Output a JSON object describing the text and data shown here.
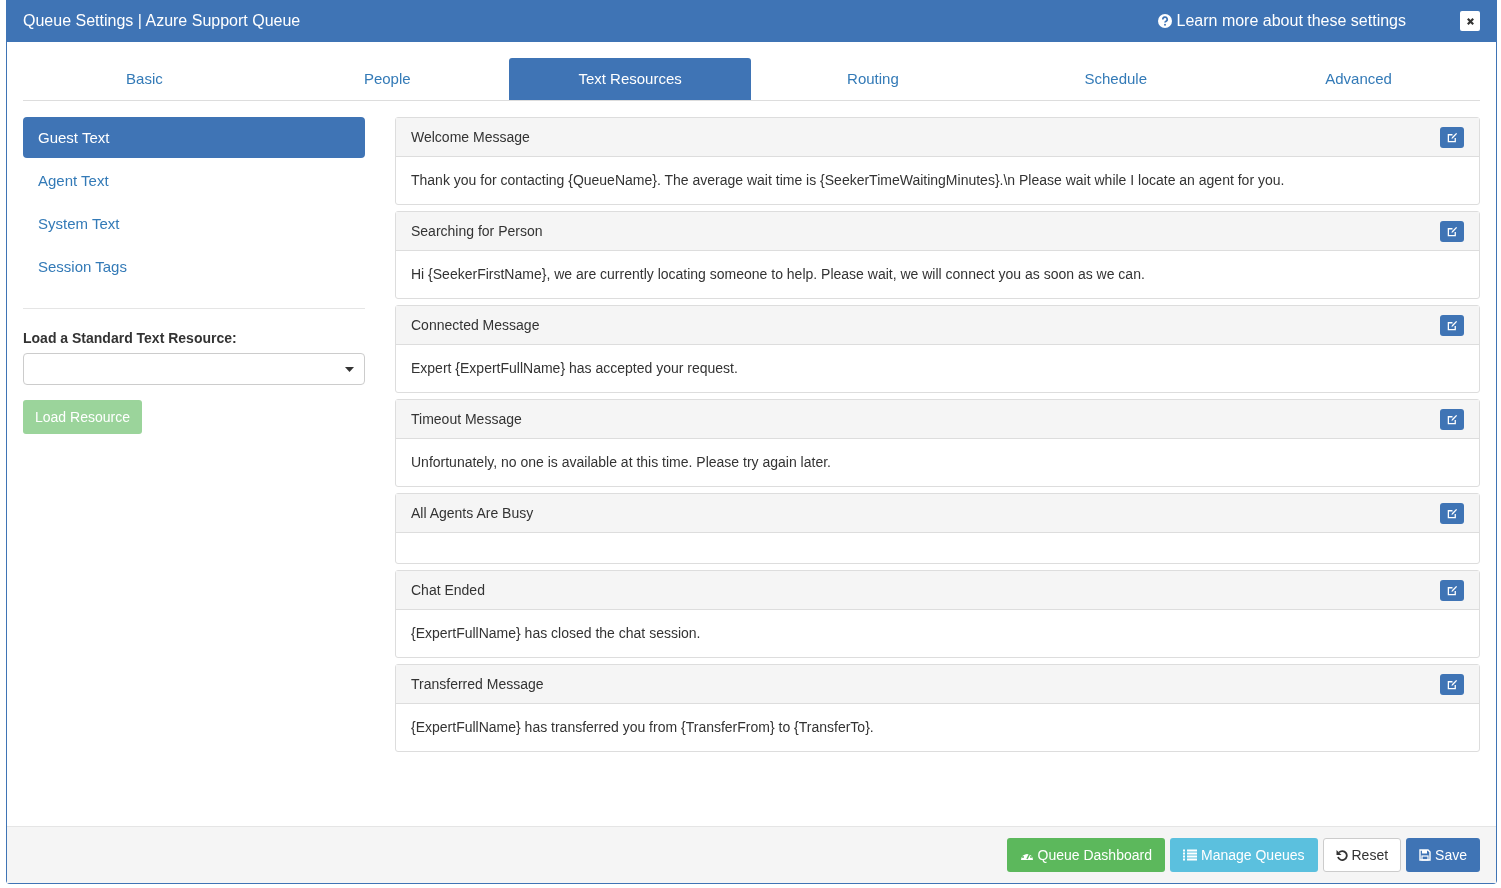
{
  "window": {
    "title": "Queue Settings | Azure Support Queue",
    "help_link": "Learn more about these settings"
  },
  "tabs": [
    {
      "label": "Basic",
      "selected": false
    },
    {
      "label": "People",
      "selected": false
    },
    {
      "label": "Text Resources",
      "selected": true
    },
    {
      "label": "Routing",
      "selected": false
    },
    {
      "label": "Schedule",
      "selected": false
    },
    {
      "label": "Advanced",
      "selected": false
    }
  ],
  "sidebar": {
    "items": [
      {
        "label": "Guest Text",
        "selected": true
      },
      {
        "label": "Agent Text",
        "selected": false
      },
      {
        "label": "System Text",
        "selected": false
      },
      {
        "label": "Session Tags",
        "selected": false
      }
    ],
    "load_label": "Load a Standard Text Resource:",
    "load_button": {
      "label": "Load Resource",
      "disabled": true
    }
  },
  "panels": [
    {
      "title": "Welcome Message",
      "text": "Thank you for contacting {QueueName}. The average wait time is {SeekerTimeWaitingMinutes}.\\n Please wait while I locate an agent for you."
    },
    {
      "title": "Searching for Person",
      "text": "Hi {SeekerFirstName}, we are currently locating someone to help. Please wait, we will connect you as soon as we can."
    },
    {
      "title": "Connected Message",
      "text": "Expert {ExpertFullName} has accepted your request."
    },
    {
      "title": "Timeout Message",
      "text": "Unfortunately, no one is available at this time. Please try again later."
    },
    {
      "title": "All Agents Are Busy"
    },
    {
      "title": "Chat Ended",
      "text": "{ExpertFullName} has closed the chat session."
    },
    {
      "title": "Transferred Message",
      "text": "{ExpertFullName} has transferred you from {TransferFrom} to {TransferTo}."
    }
  ],
  "footer_buttons": [
    {
      "label": "Queue Dashboard",
      "kind": "success"
    },
    {
      "label": "Manage Queues",
      "kind": "info"
    },
    {
      "label": "Reset",
      "kind": "default"
    },
    {
      "label": "Save",
      "kind": "primary"
    }
  ]
}
